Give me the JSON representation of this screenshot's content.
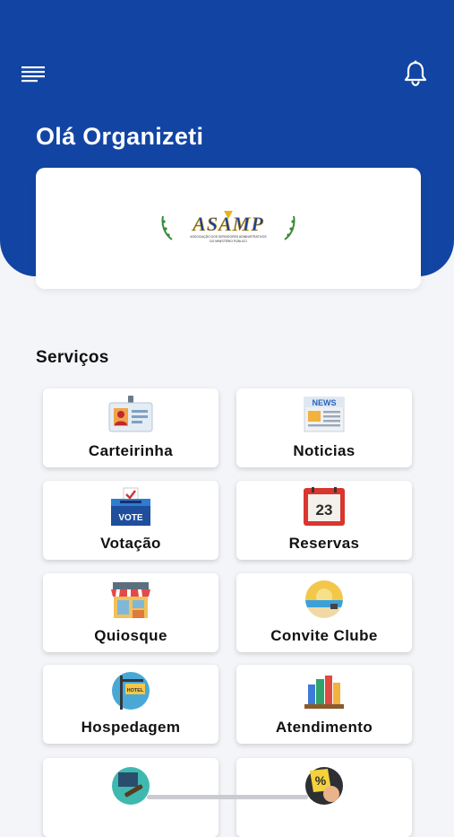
{
  "header": {
    "greeting": "Olá Organizeti",
    "menu_icon": "menu-icon",
    "notification_icon": "bell-icon",
    "brand_color": "#1245a3"
  },
  "logo": {
    "name": "ASAMP",
    "subtitle_line1": "ASSOCIAÇÃO DOS SERVIDORES ADMINISTRATIVOS",
    "subtitle_line2": "DO MINISTÉRIO PÚBLICO"
  },
  "services": {
    "title": "Serviços",
    "items": [
      {
        "label": "Carteirinha",
        "icon": "id-card-icon"
      },
      {
        "label": "Noticias",
        "icon": "newspaper-icon"
      },
      {
        "label": "Votação",
        "icon": "ballot-box-icon",
        "icon_text": "VOTE"
      },
      {
        "label": "Reservas",
        "icon": "calendar-icon",
        "icon_text": "23"
      },
      {
        "label": "Quiosque",
        "icon": "kiosk-icon"
      },
      {
        "label": "Convite Clube",
        "icon": "beach-icon"
      },
      {
        "label": "Hospedagem",
        "icon": "hotel-sign-icon",
        "icon_text": "HOTEL"
      },
      {
        "label": "Atendimento",
        "icon": "books-icon"
      },
      {
        "label": "",
        "icon": "law-book-icon"
      },
      {
        "label": "",
        "icon": "discount-icon",
        "icon_text": "%"
      }
    ]
  }
}
